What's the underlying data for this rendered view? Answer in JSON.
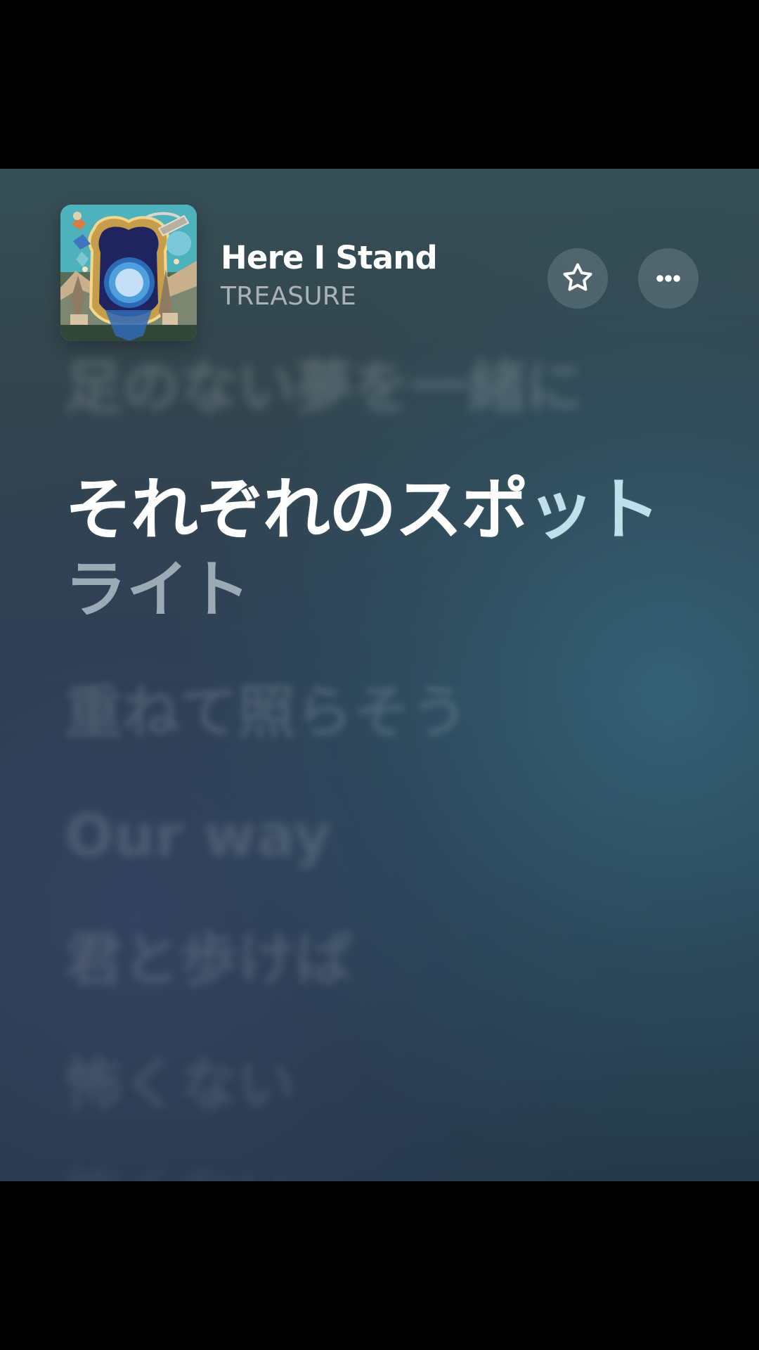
{
  "track": {
    "title": "Here I Stand",
    "artist": "TREASURE"
  },
  "icons": {
    "favorite": "star-outline-icon",
    "more": "ellipsis-icon"
  },
  "lyrics": {
    "previous_line": "足のない夢を一緒に",
    "current_line_main": "それぞれのスポ",
    "current_line_fade": "ット",
    "current_line_continued": "ライト",
    "next_lines": [
      "重ねて照らそう",
      "Our way",
      "君と歩けば",
      "怖くない"
    ]
  }
}
